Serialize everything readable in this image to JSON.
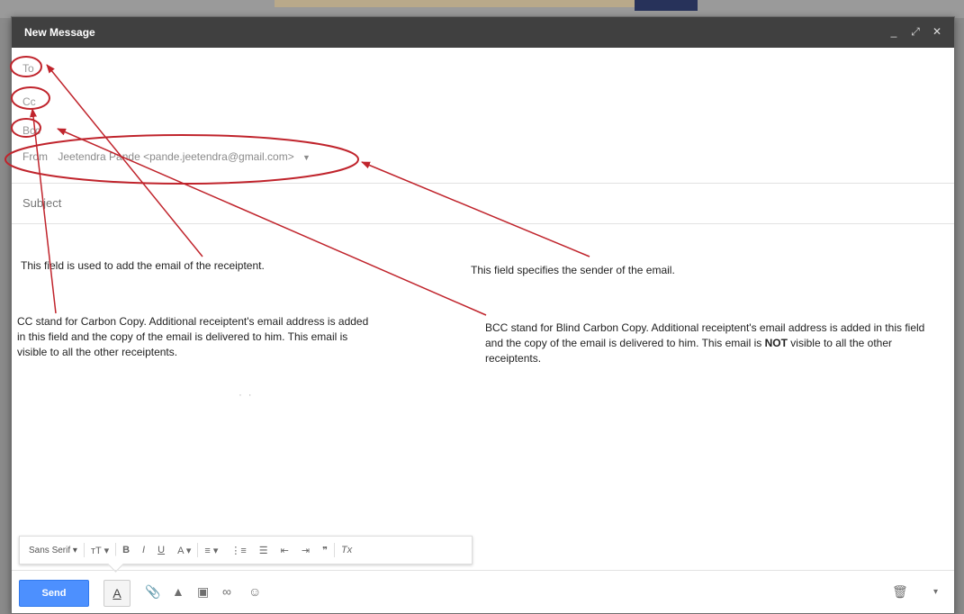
{
  "window": {
    "title": "New Message",
    "controls": {
      "minimize": "_",
      "expand": "⤢",
      "close": "✕"
    }
  },
  "fields": {
    "to_label": "To",
    "cc_label": "Cc",
    "bcc_label": "Bcc",
    "from_label": "From",
    "from_value": "Jeetendra Pande <pande.jeetendra@gmail.com>",
    "subject_placeholder": "Subject"
  },
  "annotations": {
    "to_note": "This field is used to add the email of the receiptent.",
    "from_note": "This field specifies the sender of the email.",
    "cc_note": "CC stand for Carbon Copy. Additional receiptent's email address is added in this field and the copy of the email is delivered to him. This email is visible to all the other receiptents.",
    "bcc_note_1": "BCC stand for Blind Carbon Copy. Additional receiptent's email address is added in this field and the copy of the email is delivered to him. This email is ",
    "bcc_note_bold": "NOT",
    "bcc_note_2": " visible to all the other receiptents.",
    "annotation_color": "#c0242c"
  },
  "formatting_toolbar": {
    "font": "Sans Serif",
    "font_caret": "▾",
    "size": "тT ▾",
    "bold": "B",
    "italic": "I",
    "underline": "U",
    "text_color": "A ▾",
    "align": "≡ ▾",
    "numbered_list": "⋮≡",
    "bulleted_list": "☰",
    "indent_less": "⇤",
    "indent_more": "⇥",
    "quote": "❞",
    "remove_formatting": "Tx"
  },
  "bottom_bar": {
    "send_label": "Send",
    "format_icon": "A",
    "attach_icon": "📎",
    "drive_icon": "▲",
    "photo_icon": "▣",
    "link_icon": "∞",
    "emoji_icon": "☺",
    "trash_icon": "🗑",
    "more_icon": "▾"
  },
  "accent_colors": {
    "titlebar": "#404040",
    "send": "#4d90fe"
  }
}
